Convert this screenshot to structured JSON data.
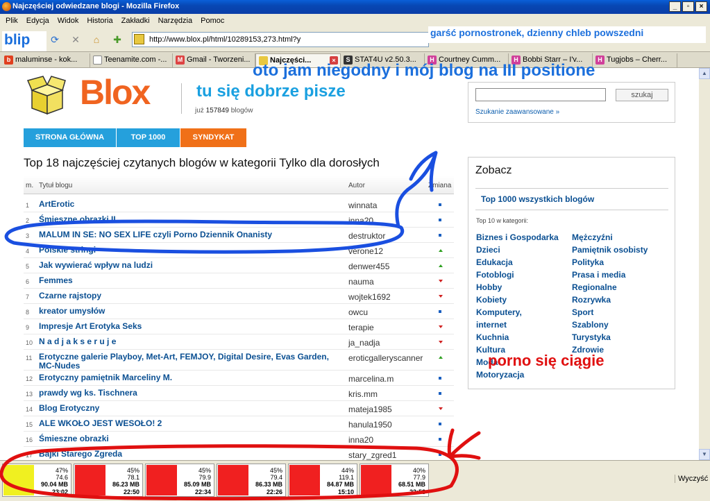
{
  "window": {
    "title": "Najczęściej odwiedzane blogi - Mozilla Firefox"
  },
  "menu": [
    "Plik",
    "Edycja",
    "Widok",
    "Historia",
    "Zakładki",
    "Narzędzia",
    "Pomoc"
  ],
  "toolbar": {
    "blip_label": "blip",
    "url": "http://www.blox.pl/html/10289153,273.html?y"
  },
  "overlay_top": "garść pornostronek, dzienny chleb powszedni",
  "tabs": [
    {
      "label": "maluminse - kok...",
      "icon": "b",
      "color": "#e04020"
    },
    {
      "label": "Teenamite.com -...",
      "icon": "",
      "color": "#ffffff"
    },
    {
      "label": "Gmail - Tworzeni...",
      "icon": "M",
      "color": "#d44"
    },
    {
      "label": "Najczęści...",
      "icon": "",
      "color": "#e8c840"
    },
    {
      "label": "STAT4U v2.50.3...",
      "icon": "S",
      "color": "#333"
    },
    {
      "label": "Courtney Cumm...",
      "icon": "H",
      "color": "#d0409a"
    },
    {
      "label": "Bobbi Starr – I'v...",
      "icon": "H",
      "color": "#d0409a"
    },
    {
      "label": "Tugjobs – Cherr...",
      "icon": "H",
      "color": "#d0409a"
    }
  ],
  "site": {
    "logo": "Blox",
    "tagline": "tu się dobrze pisze",
    "count_prefix": "już",
    "count_value": "157849",
    "count_suffix": "blogów",
    "search_button": "szukaj",
    "search_advanced": "Szukanie zaawansowane »",
    "nav": [
      {
        "label": "STRONA GŁÓWNA",
        "color": "#25a0dc"
      },
      {
        "label": "TOP 1000",
        "color": "#25a0dc"
      },
      {
        "label": "SYNDYKAT",
        "color": "#f07018"
      }
    ],
    "heading": "Top 18 najczęściej czytanych blogów w kategorii Tylko dla dorosłych",
    "table_headers": {
      "num": "m.",
      "title": "Tytuł blogu",
      "author": "Autor",
      "change": "Zmiana"
    }
  },
  "overlay_mid": "oto jam niegodny i mój blog na III positione",
  "rows": [
    {
      "n": "1",
      "title": "ArtErotic",
      "author": "winnata",
      "change": "same"
    },
    {
      "n": "2",
      "title": "Śmieszne obrazki II",
      "author": "inna20",
      "change": "same"
    },
    {
      "n": "3",
      "title": "MALUM IN SE: NO SEX LIFE czyli Porno Dziennik Onanisty",
      "author": "destruktor",
      "change": "same"
    },
    {
      "n": "4",
      "title": "Polskie stringi",
      "author": "verone12",
      "change": "up"
    },
    {
      "n": "5",
      "title": "Jak wywierać wpływ na ludzi",
      "author": "denwer455",
      "change": "up"
    },
    {
      "n": "6",
      "title": "Femmes",
      "author": "nauma",
      "change": "down"
    },
    {
      "n": "7",
      "title": "Czarne rajstopy",
      "author": "wojtek1692",
      "change": "down"
    },
    {
      "n": "8",
      "title": "kreator umysłów",
      "author": "owcu",
      "change": "same"
    },
    {
      "n": "9",
      "title": "Impresje Art Erotyka Seks",
      "author": "terapie",
      "change": "down"
    },
    {
      "n": "10",
      "title": "N a d j a k s e r u j e",
      "author": "ja_nadja",
      "change": "down"
    },
    {
      "n": "11",
      "title": "Erotyczne galerie Playboy, Met-Art, FEMJOY, Digital Desire, Evas Garden, MC-Nudes",
      "author": "eroticgalleryscanner",
      "change": "up"
    },
    {
      "n": "12",
      "title": "Erotyczny pamiętnik Marceliny M.",
      "author": "marcelina.m",
      "change": "same"
    },
    {
      "n": "13",
      "title": "prawdy wg ks. Tischnera",
      "author": "kris.mm",
      "change": "same"
    },
    {
      "n": "14",
      "title": "Blog Erotyczny",
      "author": "mateja1985",
      "change": "down"
    },
    {
      "n": "15",
      "title": "ALE WKOŁO JEST WESOŁO! 2",
      "author": "hanula1950",
      "change": "same"
    },
    {
      "n": "16",
      "title": "Śmieszne obrazki",
      "author": "inna20",
      "change": "same"
    },
    {
      "n": "17",
      "title": "Bajki Starego Zgreda",
      "author": "stary_zgred1",
      "change": "same"
    }
  ],
  "zobacz": {
    "title": "Zobacz",
    "top1000": "Top 1000 wszystkich blogów",
    "sub": "Top 10 w kategorii:",
    "col1": [
      "Biznes i Gospodarka",
      "Dzieci",
      "Edukacja",
      "Fotoblogi",
      "Hobby",
      "Kobiety",
      "Komputery,",
      "internet",
      "Kuchnia",
      "Kultura",
      "Moda",
      "Motoryzacja"
    ],
    "col2": [
      "Mężczyźni",
      "Pamiętnik osobisty",
      "Polityka",
      "Prasa i media",
      "Regionalne",
      "Rozrywka",
      "Sport",
      "Szablony",
      "Turystyka",
      "Zdrowie"
    ]
  },
  "overlay_bottom": "porno się ciągie",
  "downloads": [
    {
      "pct": "47%",
      "rate": "74.6",
      "size": "90.04 MB",
      "time": "23:02",
      "color": "#f0f020"
    },
    {
      "pct": "45%",
      "rate": "78.1",
      "size": "86.23 MB",
      "time": "22:50",
      "color": "#f02020"
    },
    {
      "pct": "45%",
      "rate": "79.9",
      "size": "85.09 MB",
      "time": "22:34",
      "color": "#f02020"
    },
    {
      "pct": "45%",
      "rate": "79.4",
      "size": "86.33 MB",
      "time": "22:26",
      "color": "#f02020"
    },
    {
      "pct": "44%",
      "rate": "119.1",
      "size": "84.87 MB",
      "time": "15:10",
      "color": "#f02020"
    },
    {
      "pct": "40%",
      "rate": "77.9",
      "size": "68.51 MB",
      "time": "22:58",
      "color": "#f02020"
    }
  ],
  "statusbar": {
    "clear": "Wyczyść"
  }
}
